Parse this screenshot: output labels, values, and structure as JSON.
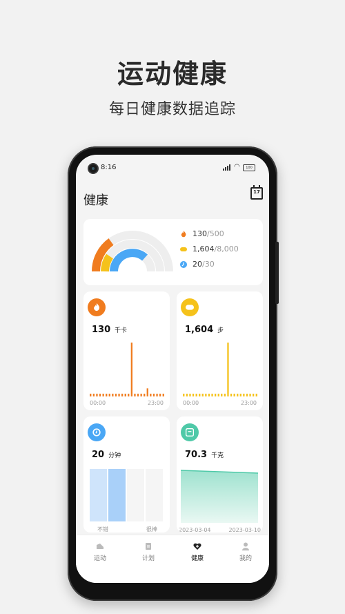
{
  "promo": {
    "title": "运动健康",
    "subtitle": "每日健康数据追踪"
  },
  "status_bar": {
    "time": "8:16",
    "battery": "100"
  },
  "header": {
    "title": "健康",
    "calendar_day": "17"
  },
  "summary": {
    "calories": {
      "value": "130",
      "goal": "/500",
      "color": "#f07c1f"
    },
    "steps": {
      "value": "1,604",
      "goal": "/8,000",
      "color": "#f5c21b"
    },
    "exercise": {
      "value": "20",
      "goal": "/30",
      "color": "#4aa7f5"
    }
  },
  "cards": {
    "calories": {
      "value": "130",
      "unit": "千卡",
      "x_start": "00:00",
      "x_end": "23:00",
      "color": "#f07c1f"
    },
    "steps": {
      "value": "1,604",
      "unit": "步",
      "x_start": "00:00",
      "x_end": "23:00",
      "color": "#f5c21b"
    },
    "exercise": {
      "value": "20",
      "unit": "分钟",
      "label_left": "不错",
      "label_right": "很棒",
      "color": "#4aa7f5"
    },
    "weight": {
      "value": "70.3",
      "unit": "千克",
      "date_start": "2023-03-04",
      "date_end": "2023-03-10",
      "color": "#4fc9a8"
    }
  },
  "chart_data": [
    {
      "type": "bar",
      "title": "calories-hourly",
      "categories": [
        "00",
        "01",
        "02",
        "03",
        "04",
        "05",
        "06",
        "07",
        "08",
        "09",
        "10",
        "11",
        "12",
        "13",
        "14",
        "15",
        "16",
        "17",
        "18",
        "19",
        "20",
        "21",
        "22",
        "23"
      ],
      "values": [
        1,
        1,
        1,
        1,
        1,
        1,
        1,
        1,
        1,
        1,
        1,
        1,
        1,
        40,
        1,
        1,
        1,
        2,
        6,
        1,
        1,
        1,
        1,
        1
      ]
    },
    {
      "type": "bar",
      "title": "steps-hourly",
      "categories": [
        "00",
        "01",
        "02",
        "03",
        "04",
        "05",
        "06",
        "07",
        "08",
        "09",
        "10",
        "11",
        "12",
        "13",
        "14",
        "15",
        "16",
        "17",
        "18",
        "19",
        "20",
        "21",
        "22",
        "23"
      ],
      "values": [
        1,
        1,
        1,
        1,
        1,
        1,
        1,
        1,
        1,
        1,
        1,
        1,
        1,
        1,
        1400,
        1,
        1,
        1,
        1,
        1,
        1,
        1,
        1,
        1
      ]
    },
    {
      "type": "area",
      "title": "weight-trend",
      "x": [
        "2023-03-04",
        "2023-03-10"
      ],
      "y": [
        70.6,
        70.3
      ]
    }
  ],
  "tabbar": {
    "items": [
      "运动",
      "计划",
      "健康",
      "我的"
    ],
    "active_index": 2
  }
}
